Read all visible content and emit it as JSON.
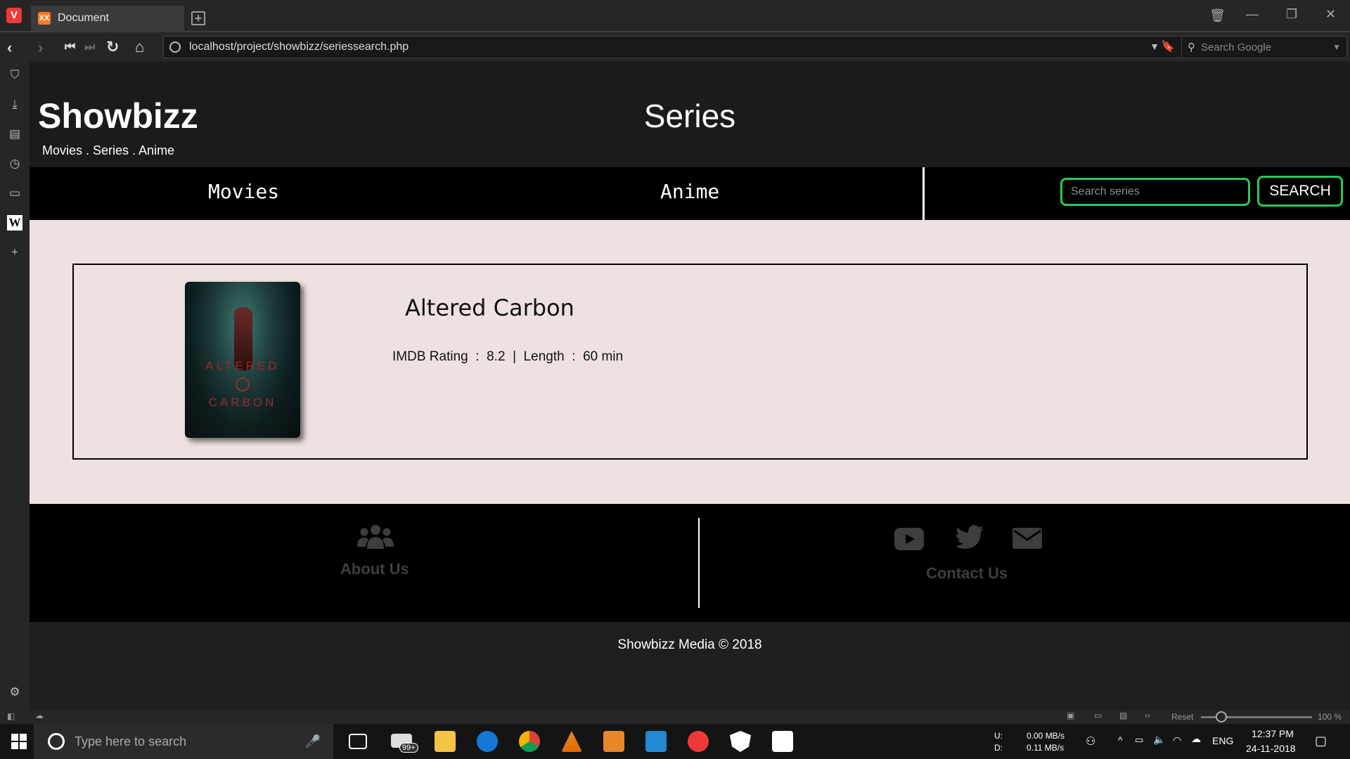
{
  "browser": {
    "logo": "V",
    "tab_title": "Document",
    "tab_favicon": "XX",
    "url": "localhost/project/showbizz/seriessearch.php",
    "search_placeholder": "Search Google"
  },
  "site": {
    "brand": "Showbizz",
    "tagline": "Movies . Series . Anime",
    "page_title": "Series"
  },
  "nav": {
    "movies": "Movies",
    "anime": "Anime",
    "search_placeholder": "Search series",
    "search_button": "SEARCH"
  },
  "result": {
    "title": "Altered Carbon",
    "poster_line1": "ALTERED",
    "poster_line2": "CARBON",
    "info": "IMDB Rating  :  8.2  |  Length  :  60 min"
  },
  "footer": {
    "about": "About Us",
    "contact": "Contact Us",
    "copyright": "Showbizz Media © 2018"
  },
  "statusbar": {
    "reset": "Reset",
    "zoom": "100 %"
  },
  "taskbar": {
    "search_placeholder": "Type here to search",
    "mail_badge": "99+",
    "net_up_label": "U:",
    "net_down_label": "D:",
    "net_up": "0.00 MB/s",
    "net_down": "0.11 MB/s",
    "lang": "ENG",
    "time": "12:37 PM",
    "date": "24-11-2018"
  },
  "colors": {
    "accent": "#28c95a",
    "content_bg": "#efe1e1",
    "browser_red": "#ef3939"
  }
}
